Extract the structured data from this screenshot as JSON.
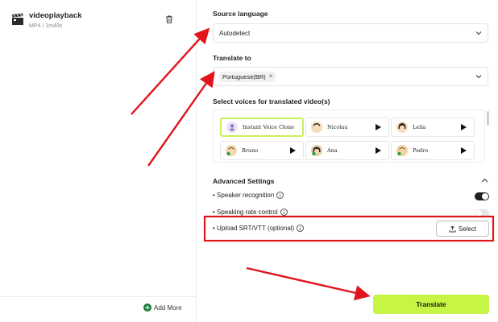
{
  "file": {
    "name": "videoplayback",
    "meta": "MP4 / 1m49s"
  },
  "left_footer": {
    "add_more_label": "Add More"
  },
  "source_language": {
    "title": "Source language",
    "value": "Autodetect"
  },
  "translate_to": {
    "title": "Translate to",
    "chips": [
      "Portuguese(BR)"
    ]
  },
  "voices": {
    "title": "Select voices for translated video(s)",
    "items": [
      {
        "name": "Instant Voice Clone",
        "selected": true,
        "avatar_color": "#e9e3f5"
      },
      {
        "name": "Nicolau",
        "selected": false,
        "avatar_color": "#f3d9b8"
      },
      {
        "name": "Leila",
        "selected": false,
        "avatar_color": "#f5dcc1"
      },
      {
        "name": "Bruno",
        "selected": false,
        "avatar_color": "#f3d6ad"
      },
      {
        "name": "Ana",
        "selected": false,
        "avatar_color": "#e9cfa7"
      },
      {
        "name": "Pedro",
        "selected": false,
        "avatar_color": "#f0d3a6"
      }
    ]
  },
  "advanced": {
    "title": "Advanced Settings",
    "options": [
      {
        "label": "• Speaker recognition",
        "toggle": "on"
      },
      {
        "label": "• Speaking rate control",
        "toggle": "off"
      },
      {
        "label": "• Upload SRT/VTT (optional)"
      }
    ],
    "select_label": "Select"
  },
  "translate_button": {
    "label": "Translate"
  },
  "colors": {
    "accent": "#c6f545",
    "annotation": "#e0151b"
  }
}
